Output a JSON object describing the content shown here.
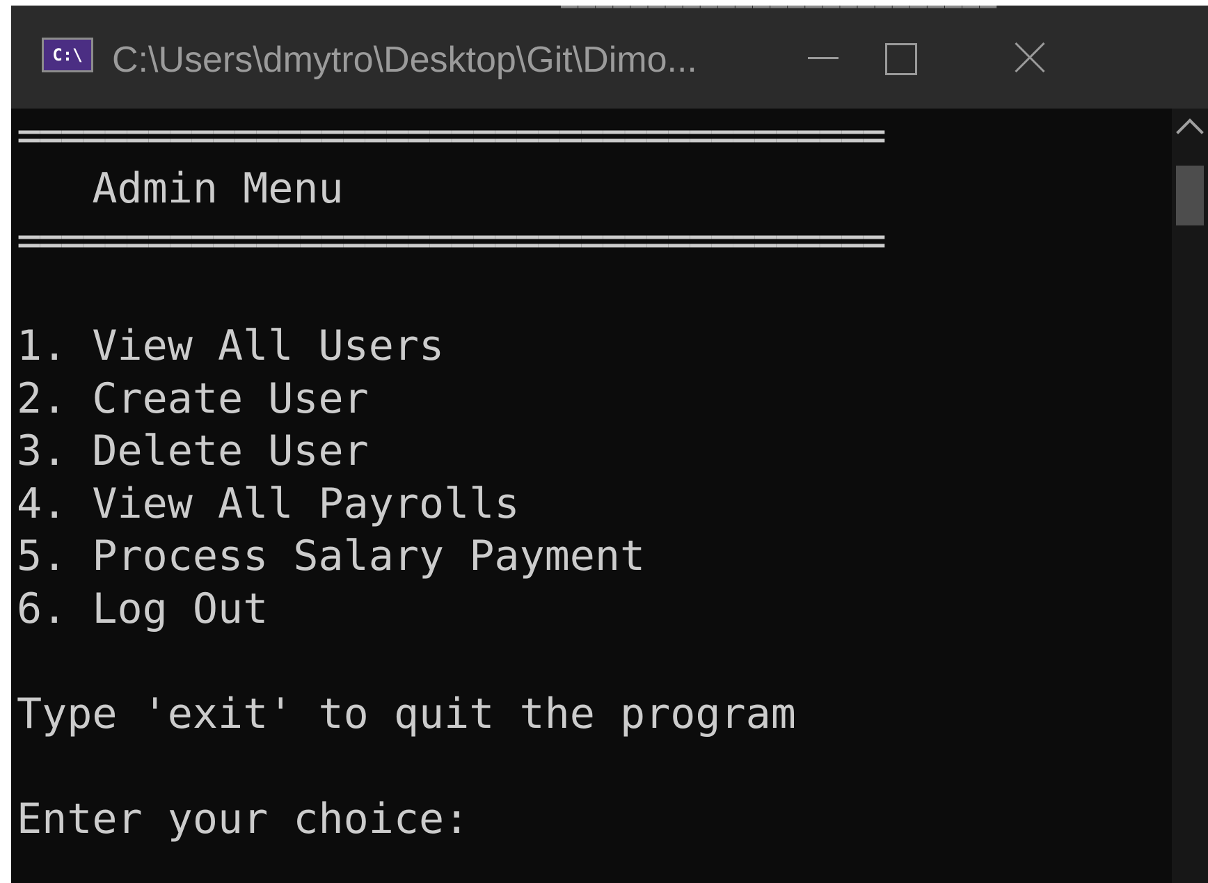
{
  "window": {
    "title": "C:\\Users\\dmytro\\Desktop\\Git\\Dimo...",
    "icon_label": "C:\\",
    "controls": {
      "minimize": "minimize-icon",
      "maximize": "maximize-icon",
      "close": "close-icon"
    },
    "titlebar_bleed_text": "▀▀▀▀▀▀▀▀▀▀▀▀▀▀▀▀▀▀▀▀▀▀▀▀▀"
  },
  "console": {
    "lines": [
      "========================================",
      "   Admin Menu",
      "========================================",
      "",
      "1. View All Users",
      "2. Create User",
      "3. Delete User",
      "4. View All Payrolls",
      "5. Process Salary Payment",
      "6. Log Out",
      "",
      "Type 'exit' to quit the program",
      "",
      "Enter your choice:",
      ""
    ]
  },
  "scrollbar": {
    "up_icon": "chevron-up-icon"
  },
  "theme": {
    "console_background": "#0c0c0c",
    "console_text": "#cccccc",
    "titlebar_background": "#2b2b2b",
    "icon_background": "#4b2e83"
  }
}
